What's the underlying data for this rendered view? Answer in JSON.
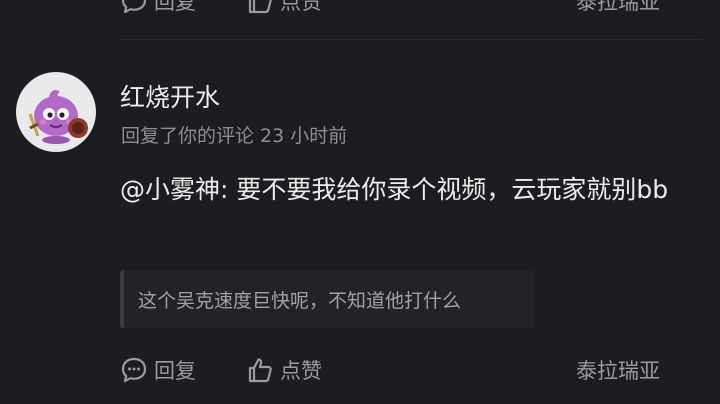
{
  "top_actions": {
    "reply_label": "回复",
    "like_label": "点赞",
    "location": "泰拉瑞亚"
  },
  "comment": {
    "username": "红烧开水",
    "meta": "回复了你的评论 23 小时前",
    "text": "@小雾神: 要不要我给你录个视频，云玩家就别bb",
    "quote": "这个吴克速度巨快呢，不知道他打什么"
  },
  "bottom_actions": {
    "reply_label": "回复",
    "like_label": "点赞",
    "location": "泰拉瑞亚"
  },
  "colors": {
    "background": "#1c1d21",
    "text_primary": "#ececec",
    "text_secondary": "#8d8e93",
    "quote_bg": "#222327"
  },
  "icons": {
    "reply": "speech-bubble-icon",
    "like": "thumbs-up-icon"
  }
}
